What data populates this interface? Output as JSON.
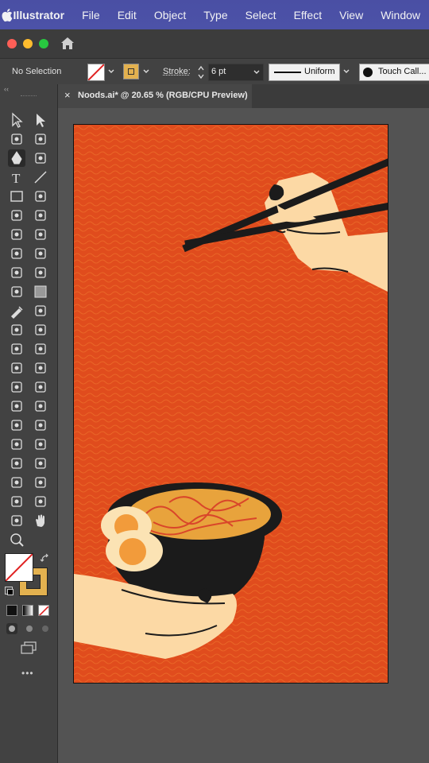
{
  "menubar": {
    "app_name": "Illustrator",
    "items": [
      "File",
      "Edit",
      "Object",
      "Type",
      "Select",
      "Effect",
      "View",
      "Window"
    ]
  },
  "control_bar": {
    "selection_label": "No Selection",
    "stroke_label": "Stroke:",
    "stroke_value": "6 pt",
    "profile_label": "Uniform",
    "brush_label": "Touch Call..."
  },
  "document_tab": {
    "title": "Noods.ai* @ 20.65 % (RGB/CPU Preview)",
    "close_glyph": "×"
  },
  "toolbar": {
    "more_glyph": "•••",
    "tools": [
      "selection-tool",
      "direct-selection-tool",
      "magic-wand-tool",
      "lasso-tool",
      "pen-tool",
      "curvature-tool",
      "type-tool",
      "line-segment-tool",
      "rectangle-tool",
      "paintbrush-tool",
      "shaper-tool",
      "scissors-tool",
      "rotate-tool",
      "scale-tool",
      "warp-tool",
      "free-transform-tool",
      "shape-builder-tool",
      "perspective-grid-tool",
      "mesh-tool",
      "gradient-tool",
      "eyedropper-tool",
      "blend-tool",
      "symbol-sprayer-tool",
      "column-graph-tool",
      "artboard-tool",
      "slice-tool",
      "puppet-warp-tool",
      "width-tool",
      "eraser-tool",
      "pattern-tool",
      "smooth-tool",
      "join-tool",
      "bristle-brush-tool",
      "path-eraser-tool",
      "shape-tool",
      "spiral-tool",
      "polar-grid-tool",
      "reshape-tool",
      "knife-tool",
      "anchor-point-tool",
      "measure-tool",
      "print-tiling-tool",
      "eyedropper-alt-tool",
      "hand-tool",
      "zoom-tool"
    ]
  },
  "colors": {
    "menubar": "#4b50a6",
    "artboard_bg": "#e04c1d",
    "wave": "#f07a2f",
    "skin": "#fcd9a5",
    "black": "#1b1b1b",
    "noodle": "#e8a33c",
    "noodle_line": "#d9462a",
    "egg_white": "#fbe3b4",
    "yolk": "#f29b3b",
    "fill_swatch": "#e3b14f"
  }
}
